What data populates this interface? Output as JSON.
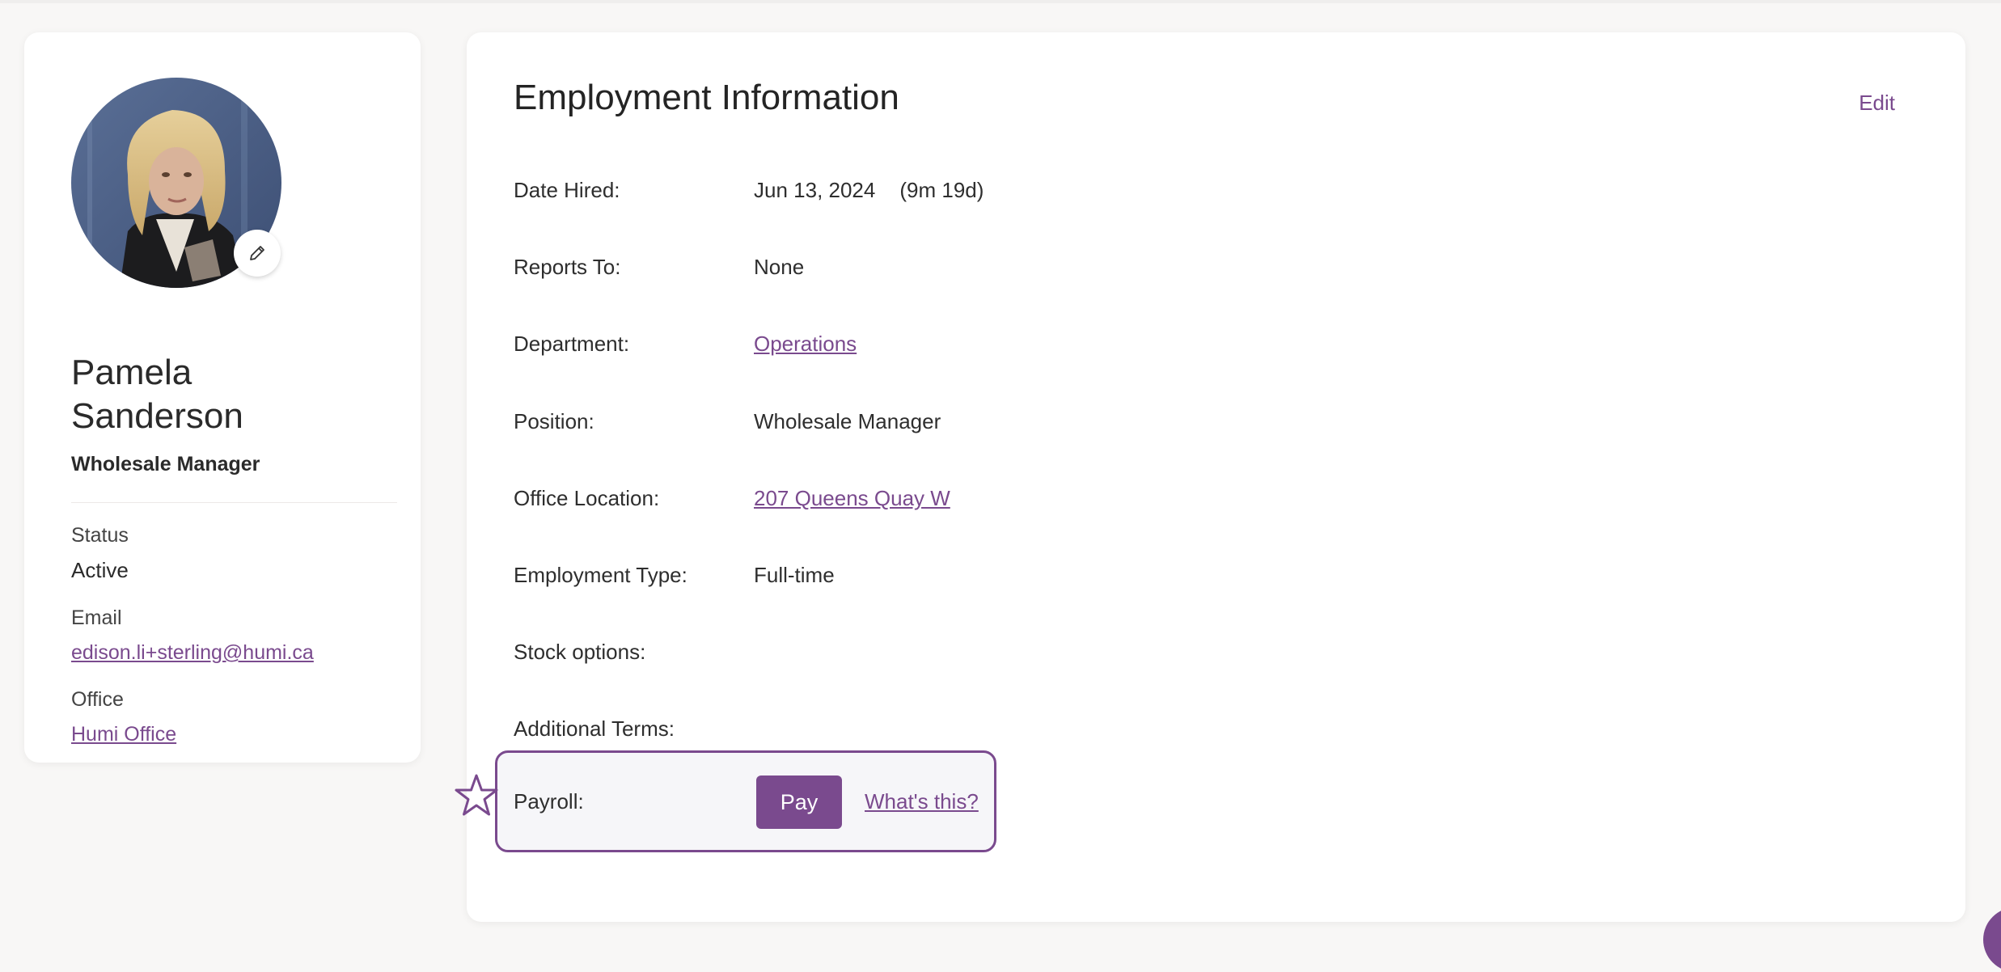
{
  "profile": {
    "avatar_alt": "Employee photo",
    "name_line1": "Pamela",
    "name_line2": "Sanderson",
    "title": "Wholesale Manager",
    "status_label": "Status",
    "status_value": "Active",
    "email_label": "Email",
    "email_value": "edison.li+sterling@humi.ca",
    "office_label": "Office",
    "office_value": "Humi Office",
    "edit_photo_icon": "pencil-icon"
  },
  "employment": {
    "title": "Employment Information",
    "edit_label": "Edit",
    "rows": [
      {
        "label": "Date Hired:",
        "value": "Jun 13, 2024",
        "extra": "(9m 19d)"
      },
      {
        "label": "Reports To:",
        "value": "None"
      },
      {
        "label": "Department:",
        "value": "Operations"
      },
      {
        "label": "Position:",
        "value": "Wholesale Manager"
      },
      {
        "label": "Office Location:",
        "value": "207 Queens Quay W"
      },
      {
        "label": "Employment Type:",
        "value": "Full-time"
      },
      {
        "label": "Stock options:",
        "value": ""
      },
      {
        "label": "Additional Terms:",
        "value": ""
      }
    ],
    "payroll": {
      "label": "Payroll:",
      "button_label": "Pay",
      "help_link": "What's this?",
      "highlight_icon": "star-icon"
    }
  },
  "colors": {
    "accent": "#7a4a8e",
    "background": "#f8f7f6",
    "card": "#ffffff"
  }
}
